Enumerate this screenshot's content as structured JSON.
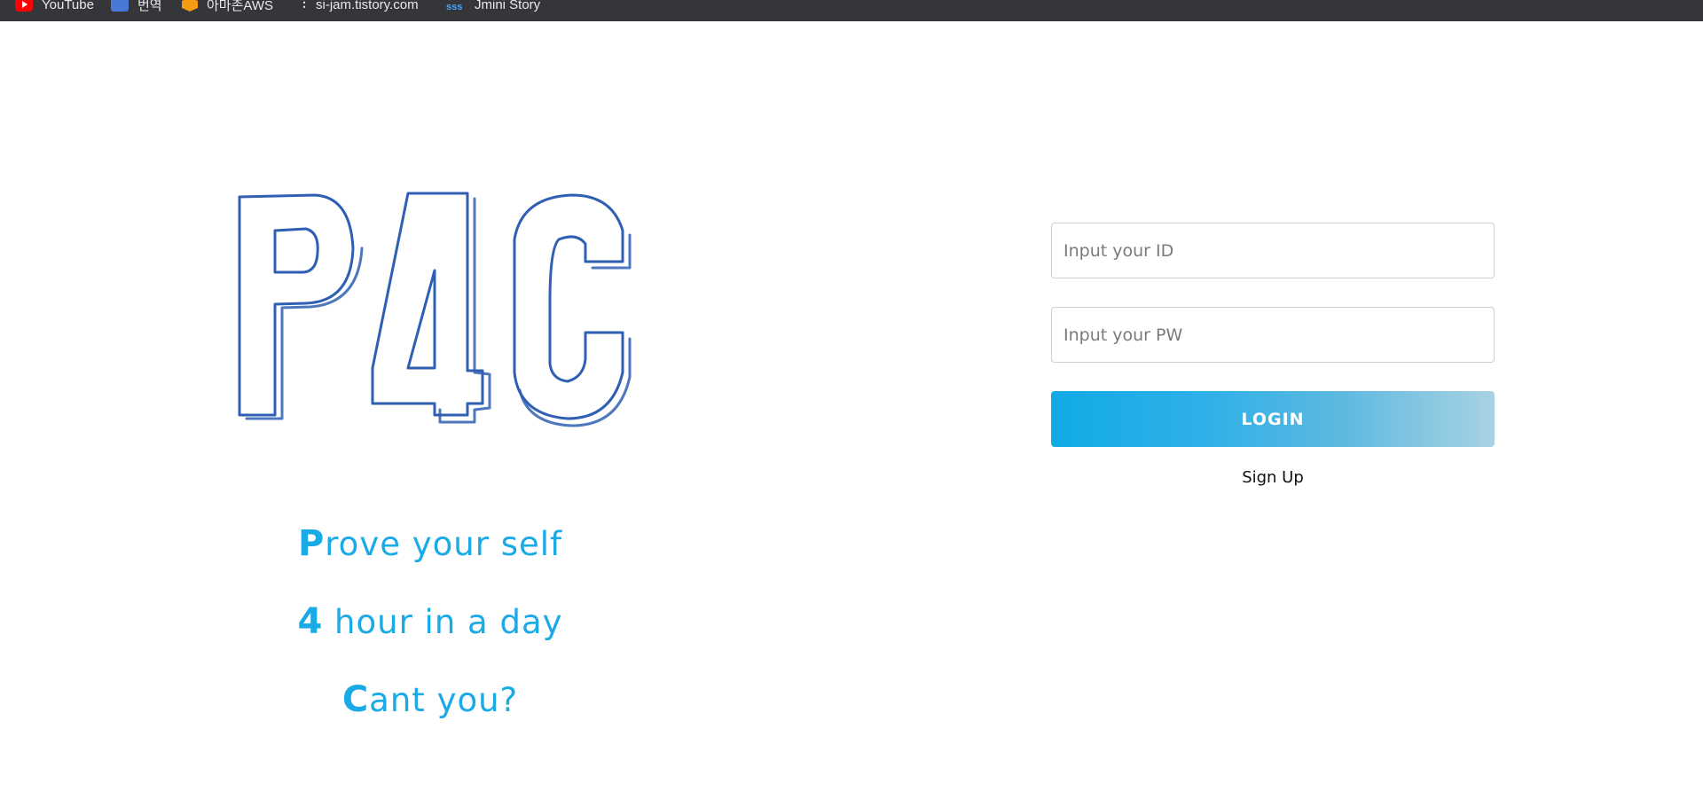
{
  "bookmarks": [
    {
      "label": "YouTube",
      "icon": "youtube-icon"
    },
    {
      "label": "번역",
      "icon": "translate-icon"
    },
    {
      "label": "아마존AWS",
      "icon": "aws-icon"
    },
    {
      "label": "si-jam.tistory.com",
      "icon": "more-dots-icon"
    },
    {
      "label": "Jmini Story",
      "icon": "sss-icon"
    }
  ],
  "logo": {
    "text": "P4C",
    "stroke_color": "#2f5fb3"
  },
  "slogan": [
    {
      "first": "P",
      "rest": "rove your self"
    },
    {
      "first": "4",
      "rest": " hour in a day"
    },
    {
      "first": "C",
      "rest": "ant you?"
    }
  ],
  "login": {
    "id_placeholder": "Input your ID",
    "pw_placeholder": "Input your PW",
    "login_label": "LOGIN",
    "signup_label": "Sign Up"
  },
  "colors": {
    "accent": "#1aaae6",
    "bookmarks_bar": "#35363a"
  }
}
